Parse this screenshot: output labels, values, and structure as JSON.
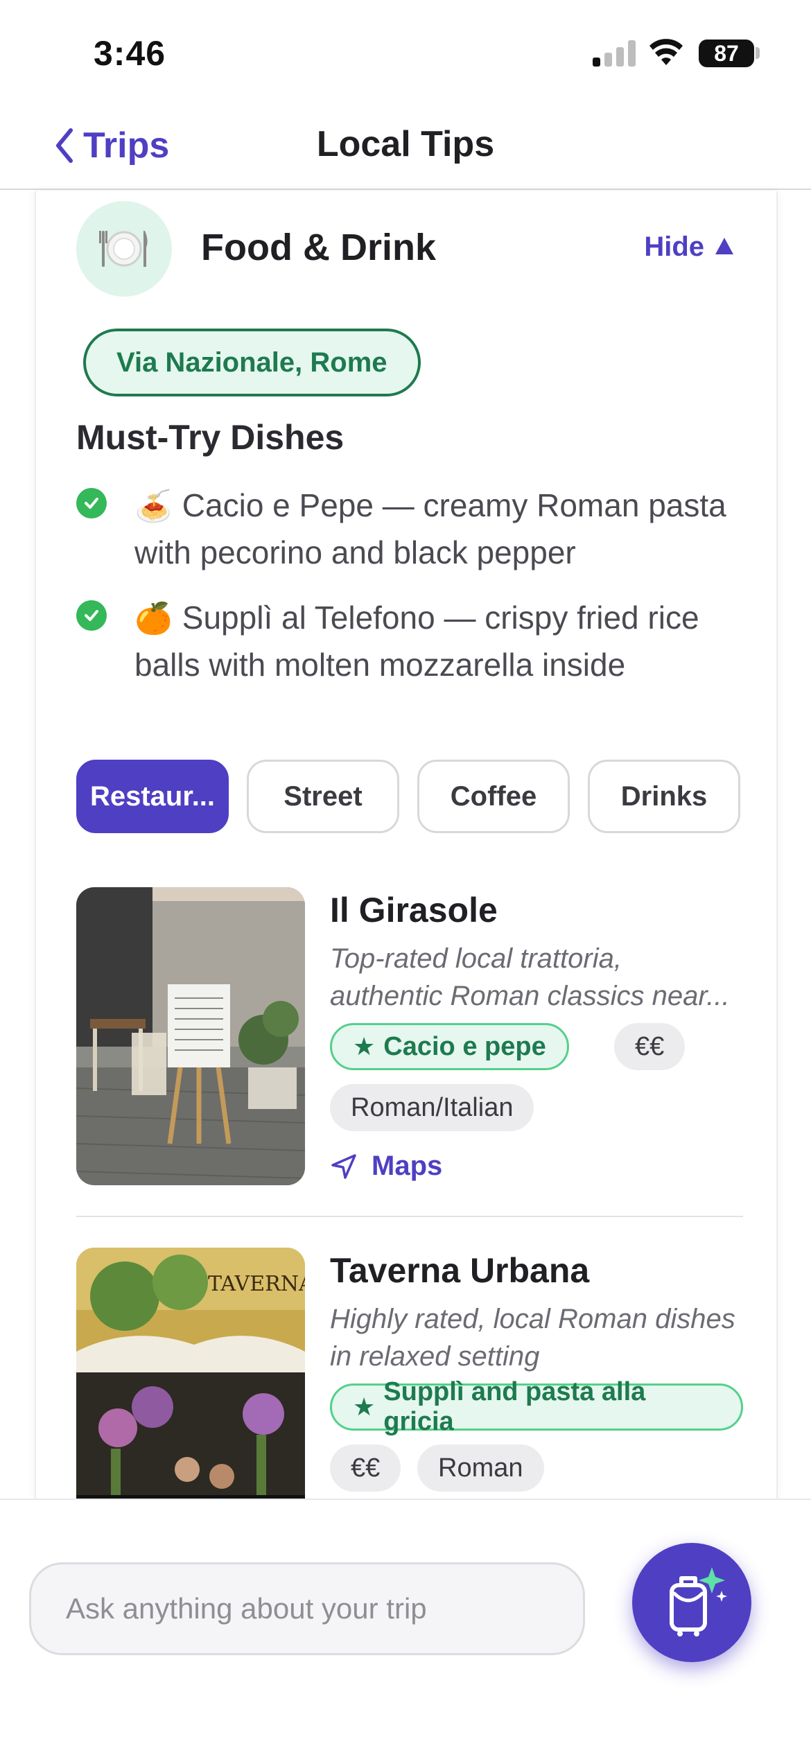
{
  "status_bar": {
    "time": "3:46",
    "battery": "87"
  },
  "nav": {
    "back_label": "Trips",
    "title": "Local Tips"
  },
  "category": {
    "icon": "plate-cutlery-icon",
    "title": "Food & Drink",
    "hide_label": "Hide",
    "location": "Via Nazionale, Rome"
  },
  "must_try": {
    "heading": "Must-Try Dishes",
    "items": [
      {
        "emoji": "🍝",
        "text": "Cacio e Pepe — creamy Roman pasta with pecorino and black pepper"
      },
      {
        "emoji": "🍊",
        "text": "Supplì al Telefono — crispy fried rice balls with molten mozzarella inside"
      }
    ]
  },
  "filters": [
    {
      "label": "Restaur...",
      "active": true
    },
    {
      "label": "Street",
      "active": false
    },
    {
      "label": "Coffee",
      "active": false
    },
    {
      "label": "Drinks",
      "active": false
    }
  ],
  "places": [
    {
      "name": "Il Girasole",
      "description": "Top-rated local trattoria, authentic Roman classics near...",
      "highlight": "Cacio e pepe",
      "price": "€€",
      "cuisine": "Roman/Italian",
      "maps_label": "Maps"
    },
    {
      "name": "Taverna Urbana",
      "description": "Highly rated, local Roman dishes in relaxed setting",
      "highlight": "Supplì and pasta alla gricia",
      "price": "€€",
      "cuisine": "Roman",
      "image_sign_text": "TAVERNA UR"
    }
  ],
  "chat": {
    "placeholder": "Ask anything about your trip"
  },
  "colors": {
    "accent": "#4f3fc3",
    "green": "#1e7a4f",
    "green_bg": "#e5f7ee"
  }
}
